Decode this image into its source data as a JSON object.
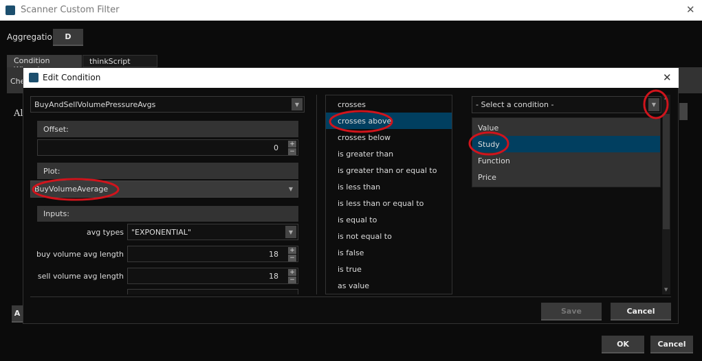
{
  "window": {
    "title": "Scanner Custom Filter",
    "close": "✕"
  },
  "aggregation": {
    "label": "Aggregation:",
    "value": "D"
  },
  "tabs": [
    {
      "label": "Condition Wizard"
    },
    {
      "label": "thinkScript Editor"
    }
  ],
  "background_fragments": {
    "che": "Che",
    "al": "Al",
    "a": "A"
  },
  "dialog": {
    "title": "Edit Condition",
    "close": "✕",
    "study": "BuyAndSellVolumePressureAvgs",
    "offset": {
      "header": "Offset:",
      "value": "0"
    },
    "plot": {
      "header": "Plot:",
      "value": "BuyVolumeAverage"
    },
    "inputs": {
      "header": "Inputs:",
      "rows": [
        {
          "label": "avg types",
          "value": "\"EXPONENTIAL\"",
          "type": "dropdown"
        },
        {
          "label": "buy volume avg length",
          "value": "18",
          "type": "number"
        },
        {
          "label": "sell volume avg length",
          "value": "18",
          "type": "number"
        }
      ]
    },
    "operators": [
      "crosses",
      "crosses above",
      "crosses below",
      "is greater than",
      "is greater than or equal to",
      "is less than",
      "is less than or equal to",
      "is equal to",
      "is not equal to",
      "is false",
      "is true",
      "as value"
    ],
    "selected_operator": "crosses above",
    "condition_select": {
      "placeholder": "- Select a condition -",
      "options": [
        "Value",
        "Study",
        "Function",
        "Price"
      ],
      "highlighted": "Study"
    },
    "save": "Save",
    "cancel": "Cancel"
  },
  "footer": {
    "ok": "OK",
    "cancel": "Cancel"
  },
  "colors": {
    "accent": "#013f60",
    "annotation": "#d0141c"
  }
}
